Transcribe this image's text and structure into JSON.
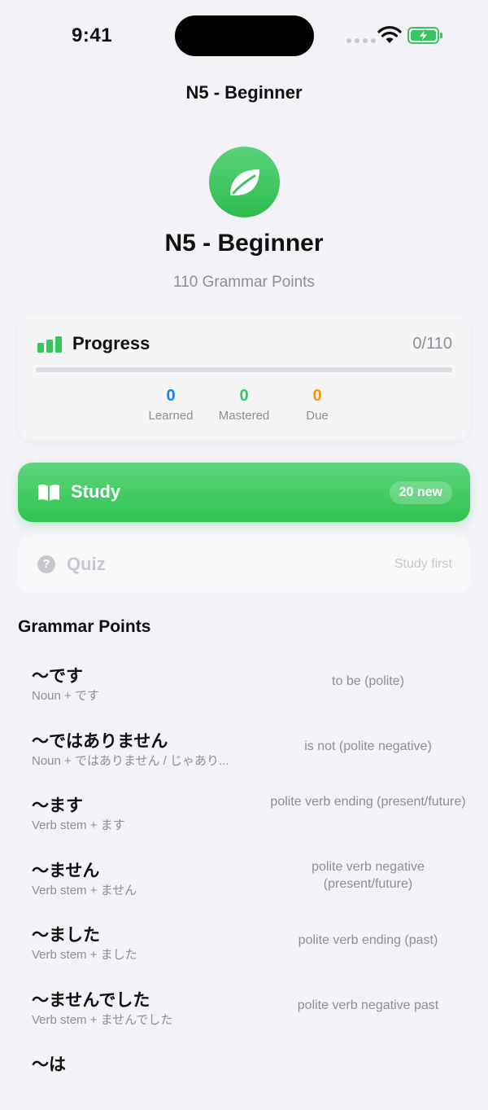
{
  "status_bar": {
    "time": "9:41"
  },
  "nav": {
    "title": "N5 - Beginner"
  },
  "level": {
    "title": "N5 - Beginner",
    "subtitle": "110 Grammar Points",
    "icon": "leaf-icon",
    "color": "#34c759"
  },
  "progress": {
    "label": "Progress",
    "count": "0/110",
    "fraction": 0,
    "stats": [
      {
        "value": "0",
        "label": "Learned",
        "color": "#0a84ff"
      },
      {
        "value": "0",
        "label": "Mastered",
        "color": "#34c759"
      },
      {
        "value": "0",
        "label": "Due",
        "color": "#ff9500"
      }
    ]
  },
  "study": {
    "label": "Study",
    "badge": "20 new",
    "icon": "book-icon"
  },
  "quiz": {
    "label": "Quiz",
    "hint": "Study first",
    "icon": "question-icon",
    "icon_glyph": "?"
  },
  "grammar": {
    "title": "Grammar Points",
    "items": [
      {
        "pattern": "～です",
        "structure": "Noun + です",
        "meaning": "to be (polite)"
      },
      {
        "pattern": "～ではありません",
        "structure": "Noun + ではありません / じゃあり...",
        "meaning": "is not (polite negative)"
      },
      {
        "pattern": "～ます",
        "structure": "Verb stem + ます",
        "meaning": "polite verb ending (present/future)"
      },
      {
        "pattern": "～ません",
        "structure": "Verb stem + ません",
        "meaning": "polite verb negative (present/future)"
      },
      {
        "pattern": "～ました",
        "structure": "Verb stem + ました",
        "meaning": "polite verb ending (past)"
      },
      {
        "pattern": "～ませんでした",
        "structure": "Verb stem + ませんでした",
        "meaning": "polite verb negative past"
      },
      {
        "pattern": "～は",
        "structure": "",
        "meaning": ""
      }
    ]
  }
}
